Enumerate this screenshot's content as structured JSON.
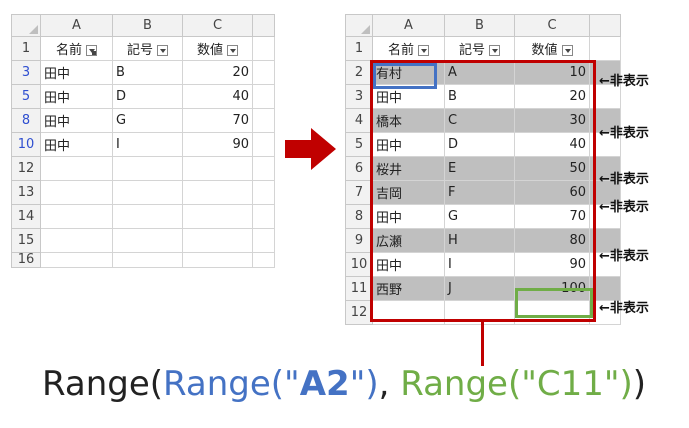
{
  "left_sheet": {
    "col_headers": [
      "A",
      "B",
      "C"
    ],
    "header_row": {
      "row": "1",
      "a": "名前",
      "b": "記号",
      "c": "数値"
    },
    "rows": [
      {
        "row": "3",
        "a": "田中",
        "b": "B",
        "c": "20"
      },
      {
        "row": "5",
        "a": "田中",
        "b": "D",
        "c": "40"
      },
      {
        "row": "8",
        "a": "田中",
        "b": "G",
        "c": "70"
      },
      {
        "row": "10",
        "a": "田中",
        "b": "I",
        "c": "90"
      },
      {
        "row": "12",
        "a": "",
        "b": "",
        "c": ""
      },
      {
        "row": "13",
        "a": "",
        "b": "",
        "c": ""
      },
      {
        "row": "14",
        "a": "",
        "b": "",
        "c": ""
      },
      {
        "row": "15",
        "a": "",
        "b": "",
        "c": ""
      },
      {
        "row": "16",
        "a": "",
        "b": "",
        "c": ""
      }
    ]
  },
  "right_sheet": {
    "col_headers": [
      "A",
      "B",
      "C"
    ],
    "header_row": {
      "row": "1",
      "a": "名前",
      "b": "記号",
      "c": "数値"
    },
    "rows": [
      {
        "row": "2",
        "a": "有村",
        "b": "A",
        "c": "10",
        "hidden": true
      },
      {
        "row": "3",
        "a": "田中",
        "b": "B",
        "c": "20",
        "hidden": false
      },
      {
        "row": "4",
        "a": "橋本",
        "b": "C",
        "c": "30",
        "hidden": true
      },
      {
        "row": "5",
        "a": "田中",
        "b": "D",
        "c": "40",
        "hidden": false
      },
      {
        "row": "6",
        "a": "桜井",
        "b": "E",
        "c": "50",
        "hidden": true
      },
      {
        "row": "7",
        "a": "吉岡",
        "b": "F",
        "c": "60",
        "hidden": true
      },
      {
        "row": "8",
        "a": "田中",
        "b": "G",
        "c": "70",
        "hidden": false
      },
      {
        "row": "9",
        "a": "広瀬",
        "b": "H",
        "c": "80",
        "hidden": true
      },
      {
        "row": "10",
        "a": "田中",
        "b": "I",
        "c": "90",
        "hidden": false
      },
      {
        "row": "11",
        "a": "西野",
        "b": "J",
        "c": "100",
        "hidden": true
      },
      {
        "row": "12",
        "a": "",
        "b": "",
        "c": "",
        "hidden": false
      }
    ]
  },
  "annotation_text": "←非表示",
  "formula": {
    "p1": "Range(",
    "p2": "Range(\"",
    "p3": "A2",
    "p4": "\")",
    "p5": ", ",
    "p6": "Range(\"C11\")",
    "p7": ")"
  },
  "colors": {
    "hidden_row_fill": "#bfbfbf",
    "range_outline": "#c00000",
    "start_cell_outline": "#4472c4",
    "end_cell_outline": "#70ad47",
    "arrow": "#c00000",
    "filtered_row_number": "#2f4fd0"
  }
}
